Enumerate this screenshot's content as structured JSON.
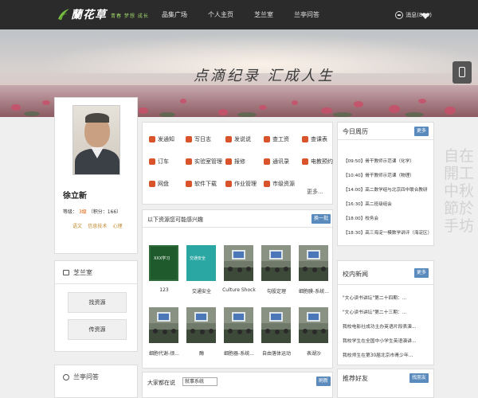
{
  "header": {
    "logo_text": "蘭花草",
    "slogan": "青春 梦想 成长",
    "nav": [
      "品集广场",
      "个人主页",
      "芝兰室",
      "兰亭问答"
    ],
    "message_label": "消息",
    "message_count": "(850)"
  },
  "banner": {
    "title": "点滴纪录 汇成人生"
  },
  "calligraphy": "自在開工中秋節於手坊",
  "profile": {
    "name": "徐立新",
    "rank_label": "等级：",
    "rank_level": "3级",
    "points": "（积分：166）",
    "tags": [
      "语文",
      "信息技术",
      "心理"
    ]
  },
  "zhilanshi": {
    "title": "芝兰室",
    "find_button": "找资源",
    "upload_button": "传资源"
  },
  "lanting": {
    "title": "兰亭问答"
  },
  "quick_links": {
    "items": [
      {
        "label": "发通知",
        "icon": "notice-icon",
        "color": "#d9532b"
      },
      {
        "label": "写日志",
        "icon": "diary-icon",
        "color": "#d9532b"
      },
      {
        "label": "发说说",
        "icon": "speech-icon",
        "color": "#d9532b"
      },
      {
        "label": "查工资",
        "icon": "eye-icon",
        "color": "#d9532b"
      },
      {
        "label": "查课表",
        "icon": "timetable-icon",
        "color": "#d9532b"
      },
      {
        "label": "订车",
        "icon": "car-icon",
        "color": "#d9532b"
      },
      {
        "label": "实验室管理",
        "icon": "lab-icon",
        "color": "#d9532b"
      },
      {
        "label": "报修",
        "icon": "wrench-icon",
        "color": "#d9532b"
      },
      {
        "label": "通讯录",
        "icon": "contacts-icon",
        "color": "#d9532b"
      },
      {
        "label": "电教预约",
        "icon": "projector-icon",
        "color": "#d9532b"
      },
      {
        "label": "网盘",
        "icon": "disk-icon",
        "color": "#d9532b"
      },
      {
        "label": "软件下载",
        "icon": "download-icon",
        "color": "#d9532b"
      },
      {
        "label": "作业管理",
        "icon": "homework-icon",
        "color": "#d9532b"
      },
      {
        "label": "市级资源",
        "icon": "city-resource-icon",
        "color": "#d9532b"
      }
    ],
    "more": "更多..."
  },
  "resources": {
    "title": "以下资源您可能感兴趣",
    "refresh_button": "换一批",
    "items": [
      {
        "caption": "123",
        "thumb_text": "XXX学习",
        "kind": "board"
      },
      {
        "caption": "交通安全",
        "thumb_text": "交通安全",
        "kind": "teal"
      },
      {
        "caption": "Culture Shock",
        "thumb_text": "",
        "kind": "classroom"
      },
      {
        "caption": "勾股定理",
        "thumb_text": "",
        "kind": "classroom"
      },
      {
        "caption": "细胞膜-系统...",
        "thumb_text": "",
        "kind": "classroom"
      },
      {
        "caption": "细胞代谢-烦...",
        "thumb_text": "",
        "kind": "classroom"
      },
      {
        "caption": "酶",
        "thumb_text": "",
        "kind": "classroom"
      },
      {
        "caption": "细胞器-系统...",
        "thumb_text": "",
        "kind": "classroom"
      },
      {
        "caption": "自由落体运动",
        "thumb_text": "",
        "kind": "classroom"
      },
      {
        "caption": "表湖沙",
        "thumb_text": "",
        "kind": "classroom"
      }
    ]
  },
  "hot_topics": {
    "title": "大家都在说",
    "select_value": "就事系统",
    "refresh_button": "刷新"
  },
  "calendar": {
    "title": "今日周历",
    "more_button": "更多",
    "items": [
      "【09:50】骨干教师示范课（化学）",
      "【10:40】骨干教师示范课（物理）",
      "【14:00】高二数学组与北京四中联合教研",
      "【16:30】高二班级组会",
      "【18:00】校务会",
      "【18:30】高三海淀一模数学讲评（海淀区）"
    ]
  },
  "news": {
    "title": "校内新闻",
    "more_button": "更多",
    "items": [
      "\"文心读书讲坛\"第二十四期：...",
      "\"文心读书讲坛\"第二十三期：...",
      "我校电影社成功主办英语片段表演...",
      "我校学生在全国中小学生英语演讲...",
      "我校师生在第30届北京市青少年..."
    ]
  },
  "friends": {
    "title": "推荐好友",
    "find_button": "找朋友"
  }
}
